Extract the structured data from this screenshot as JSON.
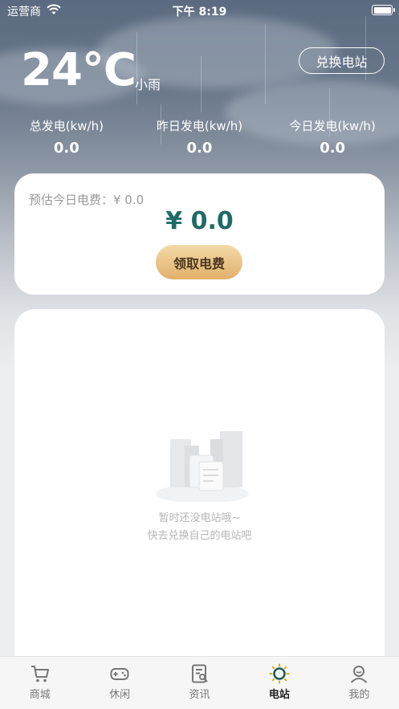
{
  "status_bar": {
    "carrier": "运营商",
    "time": "下午 8:19"
  },
  "weather": {
    "temperature": "24°C",
    "condition": "小雨"
  },
  "header": {
    "redeem_button": "兑换电站"
  },
  "stats": [
    {
      "label": "总发电(kw/h)",
      "value": "0.0"
    },
    {
      "label": "昨日发电(kw/h)",
      "value": "0.0"
    },
    {
      "label": "今日发电(kw/h)",
      "value": "0.0"
    }
  ],
  "fee_card": {
    "estimate": "预估今日电费：¥ 0.0",
    "amount": "¥ 0.0",
    "claim_button": "领取电费"
  },
  "empty_state": {
    "line1": "暂时还没电站哦~",
    "line2": "快去兑换自己的电站吧"
  },
  "tabbar": {
    "active": "电站",
    "items": [
      {
        "label": "商城",
        "icon": "cart-icon"
      },
      {
        "label": "休闲",
        "icon": "gamepad-icon"
      },
      {
        "label": "资讯",
        "icon": "news-icon"
      },
      {
        "label": "电站",
        "icon": "station-icon"
      },
      {
        "label": "我的",
        "icon": "profile-icon"
      }
    ]
  },
  "colors": {
    "accent": "#1e6b66",
    "button_gold": "#e1b06a",
    "hero_top": "#5b6a80"
  }
}
